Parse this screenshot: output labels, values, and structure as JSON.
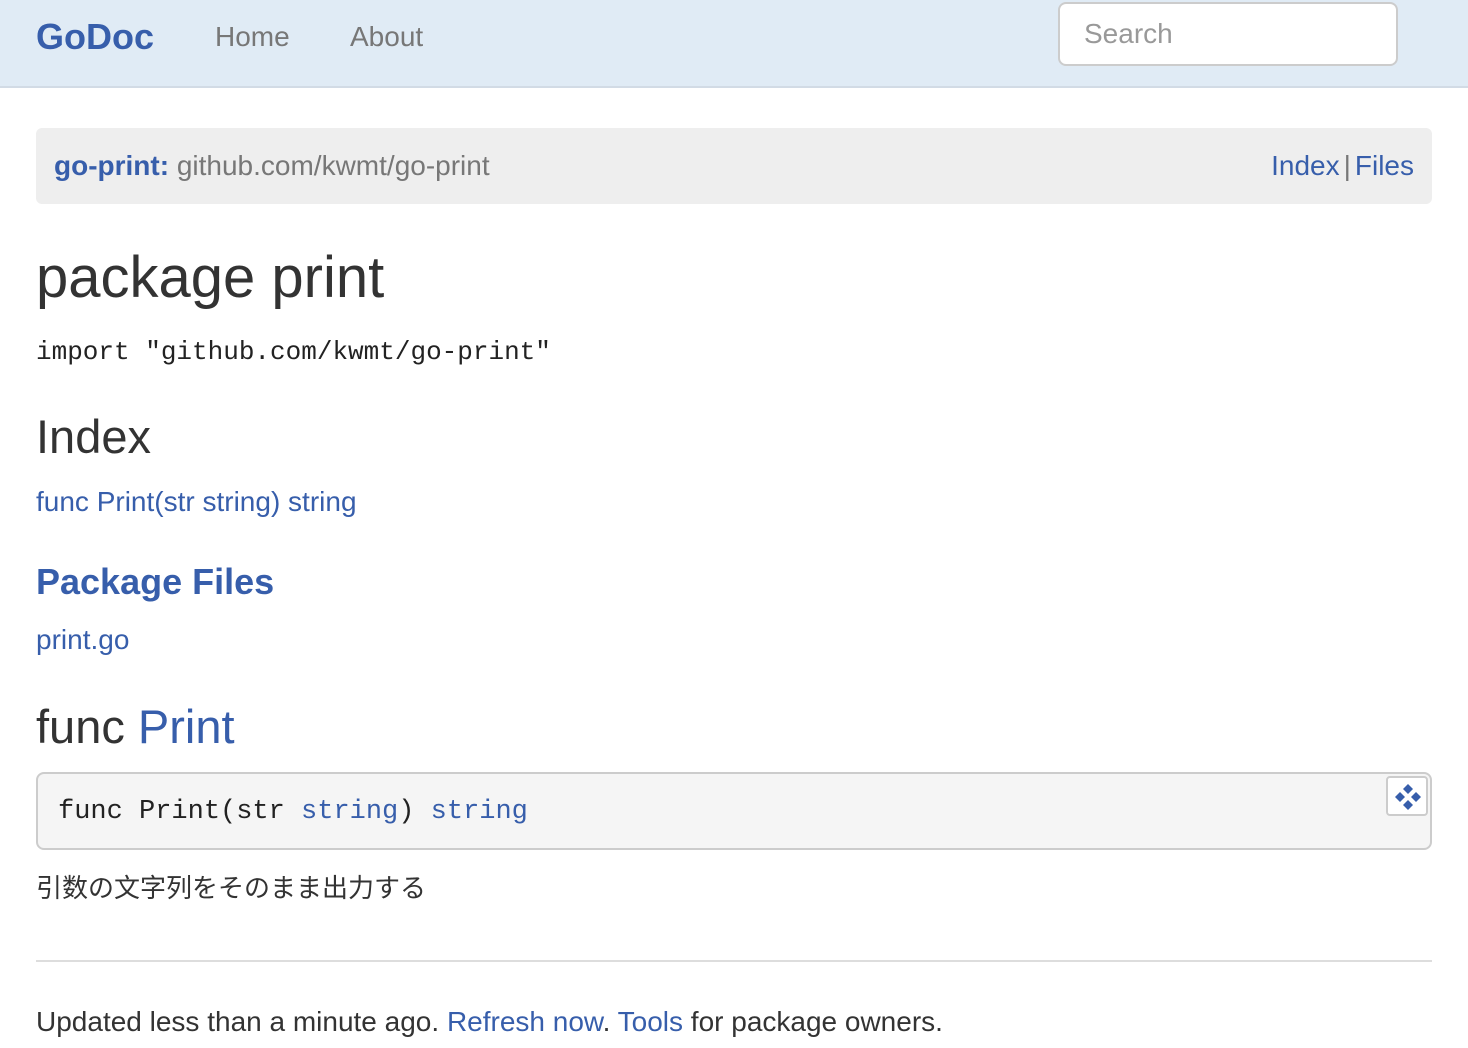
{
  "navbar": {
    "brand": "GoDoc",
    "links": [
      "Home",
      "About"
    ],
    "search_placeholder": "Search"
  },
  "breadcrumb": {
    "package_name": "go-print:",
    "import_path": "github.com/kwmt/go-print",
    "links": [
      "Index",
      "Files"
    ],
    "separator": "|"
  },
  "main": {
    "title": "package print",
    "import_line": "import \"github.com/kwmt/go-print\"",
    "index_heading": "Index",
    "index_entry": "func Print(str string) string",
    "files_heading": "Package Files",
    "files": [
      "print.go"
    ],
    "func_heading_prefix": "func",
    "func_heading_name": "Print",
    "signature": {
      "prefix": "func Print(str ",
      "param_type": "string",
      "middle": ") ",
      "return_type": "string"
    },
    "description": "引数の文字列をそのまま出力する"
  },
  "footer": {
    "text1": "Updated less than a minute ago.",
    "link1": "Refresh now",
    "text2": ".",
    "link2": "Tools",
    "text3": "for package owners."
  },
  "colors": {
    "link": "#375eab",
    "navbar_bg": "#e0ebf5",
    "crumb_bg": "#eeeeee",
    "code_bg": "#f5f5f5"
  },
  "icons": {
    "expand": "expand-diamond-icon"
  }
}
